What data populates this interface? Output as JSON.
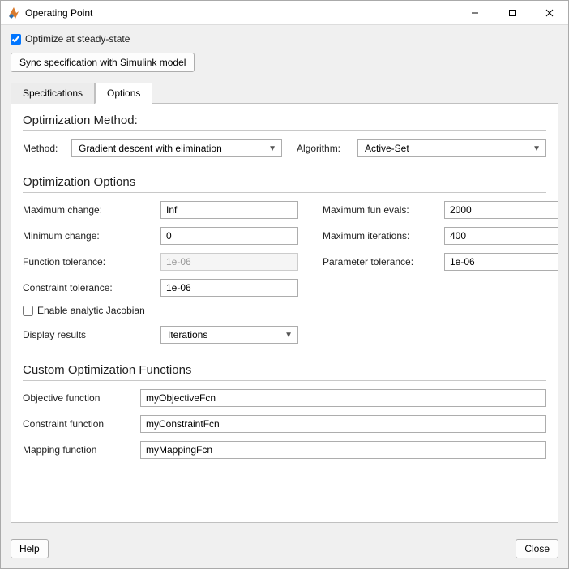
{
  "window": {
    "title": "Operating Point"
  },
  "top": {
    "optimize_checkbox_label": "Optimize at steady-state",
    "optimize_checked": true,
    "sync_button": "Sync specification with Simulink model"
  },
  "tabs": {
    "spec": "Specifications",
    "options": "Options",
    "active": "Options"
  },
  "optimization_method": {
    "heading": "Optimization Method:",
    "method_label": "Method:",
    "method_value": "Gradient descent with elimination",
    "algorithm_label": "Algorithm:",
    "algorithm_value": "Active-Set"
  },
  "optimization_options": {
    "heading": "Optimization Options",
    "max_change_label": "Maximum change:",
    "max_change_value": "Inf",
    "min_change_label": "Minimum change:",
    "min_change_value": "0",
    "fun_tol_label": "Function tolerance:",
    "fun_tol_value": "1e-06",
    "con_tol_label": "Constraint tolerance:",
    "con_tol_value": "1e-06",
    "max_fun_evals_label": "Maximum fun evals:",
    "max_fun_evals_value": "2000",
    "max_iter_label": "Maximum iterations:",
    "max_iter_value": "400",
    "param_tol_label": "Parameter tolerance:",
    "param_tol_value": "1e-06",
    "enable_jacobian_label": "Enable analytic Jacobian",
    "enable_jacobian_checked": false,
    "display_results_label": "Display results",
    "display_results_value": "Iterations"
  },
  "custom_functions": {
    "heading": "Custom Optimization Functions",
    "objective_label": "Objective function",
    "objective_value": "myObjectiveFcn",
    "constraint_label": "Constraint function",
    "constraint_value": "myConstraintFcn",
    "mapping_label": "Mapping function",
    "mapping_value": "myMappingFcn"
  },
  "footer": {
    "help": "Help",
    "close": "Close"
  }
}
